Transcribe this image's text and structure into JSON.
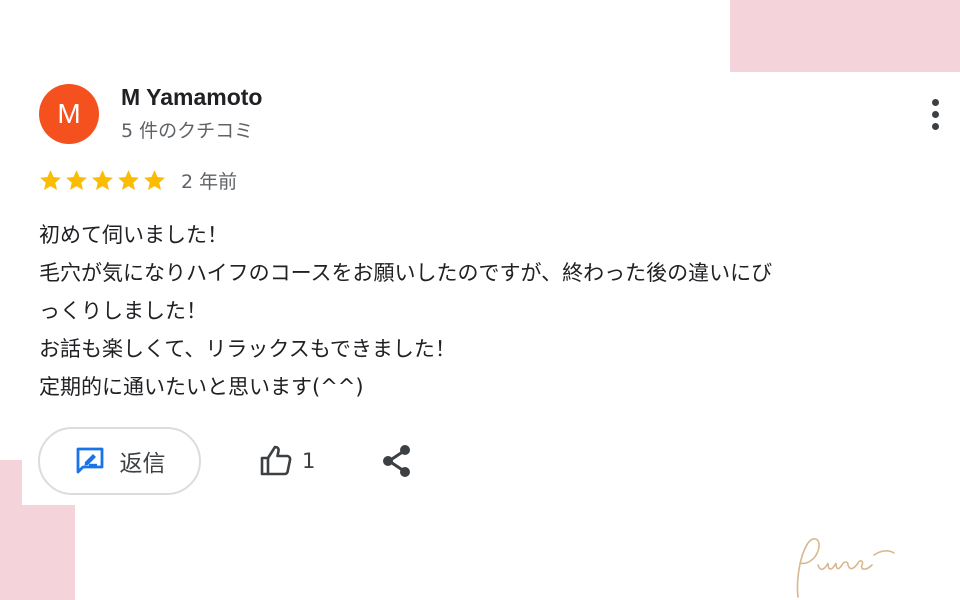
{
  "reviewer": {
    "avatar_letter": "M",
    "name": "M Yamamoto",
    "meta": "5 件のクチコミ"
  },
  "review": {
    "rating": 5,
    "rating_max": 5,
    "time": "2 年前",
    "lines": [
      "初めて伺いました！",
      "毛穴が気になりハイフのコースをお願いしたのですが、終わった後の違いにび",
      "っくりしました！",
      "お話も楽しくて、リラックスもできました！",
      "定期的に通いたいと思います(^^)"
    ]
  },
  "actions": {
    "reply_label": "返信",
    "like_count": "1"
  },
  "colors": {
    "avatar": "#f4511e",
    "star": "#fbbc04",
    "accent_blue": "#1a73e8",
    "decor_pink": "#f5d3da",
    "signature": "#d8b88f"
  },
  "icons": {
    "more": "more-vert-icon",
    "star": "star-icon",
    "reply": "reply-icon",
    "like": "thumb-up-icon",
    "share": "share-icon"
  },
  "decor": {
    "signature_text": "Pure"
  }
}
